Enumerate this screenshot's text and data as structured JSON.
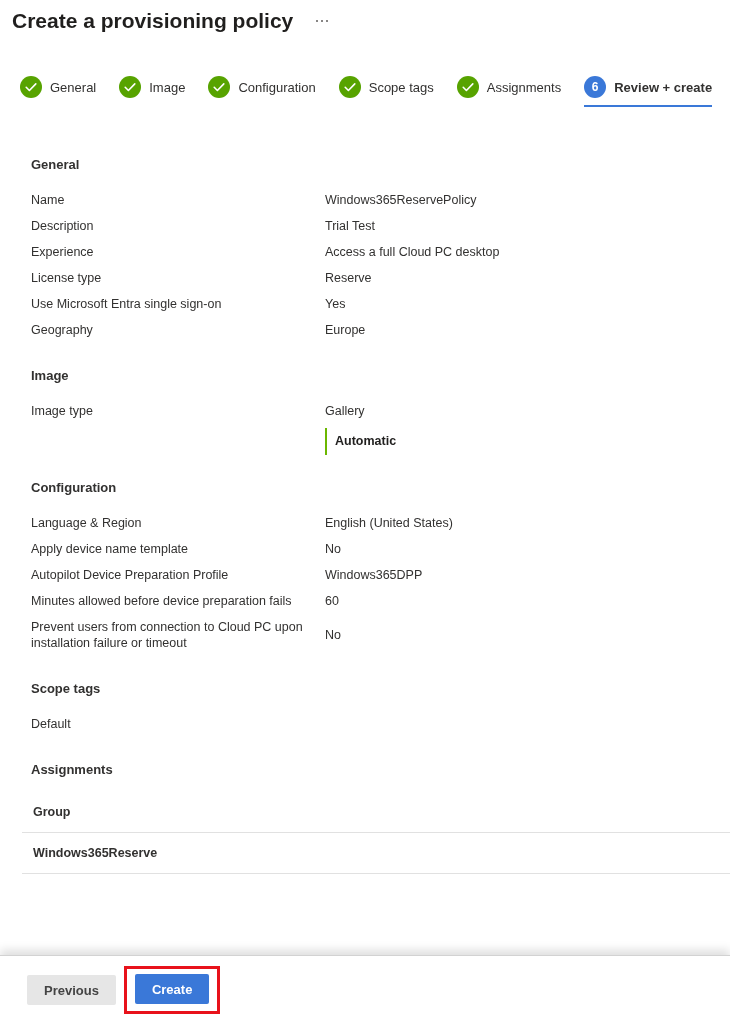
{
  "page": {
    "title": "Create a provisioning policy"
  },
  "steps": [
    {
      "label": "General",
      "kind": "done",
      "selected": false
    },
    {
      "label": "Image",
      "kind": "done",
      "selected": false
    },
    {
      "label": "Configuration",
      "kind": "done",
      "selected": false
    },
    {
      "label": "Scope tags",
      "kind": "done",
      "selected": false
    },
    {
      "label": "Assignments",
      "kind": "done",
      "selected": false
    },
    {
      "label": "Review + create",
      "kind": "current",
      "number": "6",
      "selected": true
    }
  ],
  "sections": [
    {
      "title": "General",
      "kind": "pairs",
      "rows": [
        {
          "label": "Name",
          "value": "Windows365ReservePolicy"
        },
        {
          "label": "Description",
          "value": "Trial Test"
        },
        {
          "label": "Experience",
          "value": "Access a full Cloud PC desktop"
        },
        {
          "label": "License type",
          "value": "Reserve"
        },
        {
          "label": "Use Microsoft Entra single sign-on",
          "value": "Yes"
        },
        {
          "label": "Geography",
          "value": "Europe"
        }
      ]
    },
    {
      "title": "Image",
      "kind": "pairs",
      "rows": [
        {
          "label": "Image type",
          "value": "Gallery",
          "detail": "Automatic"
        }
      ]
    },
    {
      "title": "Configuration",
      "kind": "pairs",
      "rows": [
        {
          "label": "Language & Region",
          "value": "English (United States)"
        },
        {
          "label": "Apply device name template",
          "value": "No"
        },
        {
          "label": "Autopilot Device Preparation Profile",
          "value": "Windows365DPP"
        },
        {
          "label": "Minutes allowed before device preparation fails",
          "value": "60"
        },
        {
          "label": "Prevent users from connection to Cloud PC upon installation failure or timeout",
          "value": "No"
        }
      ]
    },
    {
      "title": "Scope tags",
      "kind": "list",
      "items": [
        "Default"
      ]
    },
    {
      "title": "Assignments",
      "kind": "table",
      "columns": [
        "Group"
      ],
      "rows": [
        [
          "Windows365Reserve"
        ]
      ]
    }
  ],
  "footer": {
    "buttons": [
      {
        "label": "Previous",
        "kind": "secondary",
        "highlighted": false
      },
      {
        "label": "Create",
        "kind": "primary",
        "highlighted": true
      }
    ]
  }
}
